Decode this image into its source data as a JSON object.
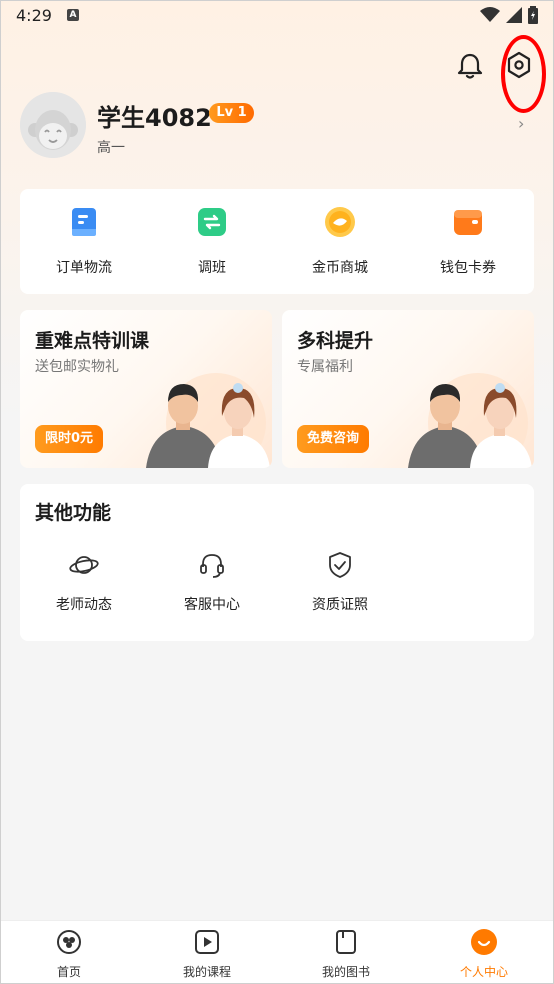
{
  "status_bar": {
    "time": "4:29",
    "a_badge": "A"
  },
  "profile": {
    "username": "学生4082",
    "level": "Lv 1",
    "grade": "高一",
    "chevron": "›"
  },
  "quick_actions": [
    {
      "label": "订单物流",
      "icon": "order-icon",
      "color": "#3a8cf3"
    },
    {
      "label": "调班",
      "icon": "transfer-icon",
      "color": "#2ecc87"
    },
    {
      "label": "金币商城",
      "icon": "coin-icon",
      "color": "#ffb21e"
    },
    {
      "label": "钱包卡券",
      "icon": "wallet-icon",
      "color": "#ff7a1a"
    }
  ],
  "promos": [
    {
      "title": "重难点特训课",
      "subtitle": "送包邮实物礼",
      "button": "限时0元"
    },
    {
      "title": "多科提升",
      "subtitle": "专属福利",
      "button": "免费咨询"
    }
  ],
  "other": {
    "title": "其他功能",
    "items": [
      {
        "label": "老师动态",
        "icon": "planet-icon"
      },
      {
        "label": "客服中心",
        "icon": "headset-icon"
      },
      {
        "label": "资质证照",
        "icon": "shield-check-icon"
      }
    ]
  },
  "bottom_nav": [
    {
      "label": "首页",
      "icon": "home-icon",
      "active": false
    },
    {
      "label": "我的课程",
      "icon": "play-icon",
      "active": false
    },
    {
      "label": "我的图书",
      "icon": "book-icon",
      "active": false
    },
    {
      "label": "个人中心",
      "icon": "profile-icon",
      "active": true
    }
  ],
  "colors": {
    "accent": "#ff7a00",
    "annotation": "#ff0000"
  }
}
